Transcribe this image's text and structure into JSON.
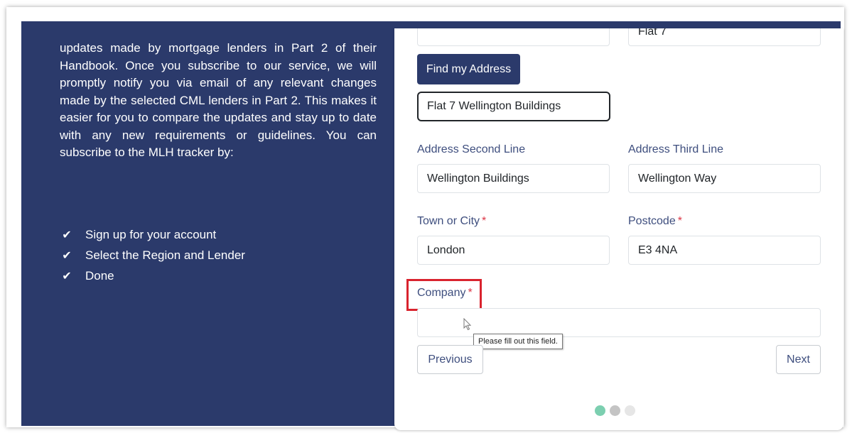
{
  "info": {
    "description": "updates made by mortgage lenders in Part 2 of their Handbook. Once you subscribe to our service, we will promptly notify you via email of any relevant changes made by the selected CML lenders in Part 2. This makes it easier for you to compare the updates and stay up to date with any new requirements or guidelines. You can subscribe to the MLH tracker by:",
    "steps": [
      "Sign up for your account",
      "Select the Region and Lender",
      "Done"
    ]
  },
  "form": {
    "flat_value": "Flat 7",
    "find_address_label": "Find my Address",
    "address_first_line_value": "Flat 7 Wellington Buildings",
    "address_second_line_label": "Address Second Line",
    "address_second_line_value": "Wellington Buildings",
    "address_third_line_label": "Address Third Line",
    "address_third_line_value": "Wellington Way",
    "town_label": "Town or City",
    "town_value": "London",
    "postcode_label": "Postcode",
    "postcode_value": "E3 4NA",
    "company_label": "Company",
    "company_value": "",
    "required_mark": "*",
    "validation_tooltip": "Please fill out this field.",
    "previous_label": "Previous",
    "next_label": "Next"
  },
  "pagination": {
    "total_steps": 3,
    "active_step": 1
  },
  "colors": {
    "panel_bg": "#2b3a6b",
    "primary_button": "#2b3a6b",
    "label_text": "#3e4e7e",
    "required": "#dc3545",
    "highlight_box": "#d9232e",
    "dot_active": "#7ccfb0",
    "dot_inactive": "#c4c4c4",
    "dot_faint": "#e6e6e6"
  }
}
